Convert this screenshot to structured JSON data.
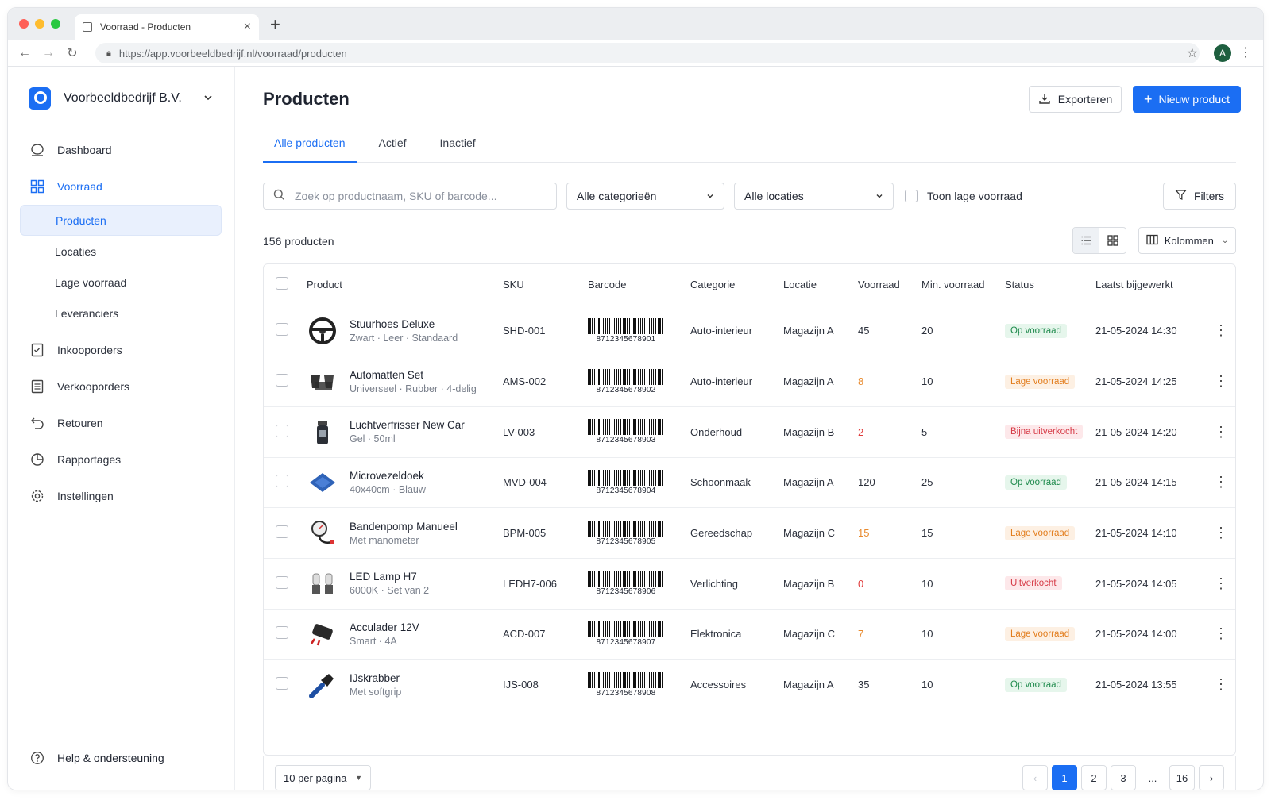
{
  "browser": {
    "tab_title": "Voorraad - Producten",
    "url": "https://app.voorbeeldbedrijf.nl/voorraad/producten",
    "profile_initial": "A"
  },
  "sidebar": {
    "org_name": "Voorbeeldbedrijf B.V.",
    "items": [
      {
        "label": "Dashboard",
        "icon": "chat-bubble-icon"
      },
      {
        "label": "Voorraad",
        "icon": "grid-icon"
      },
      {
        "label": "Inkooporders",
        "icon": "clipboard-check-icon"
      },
      {
        "label": "Verkooporders",
        "icon": "list-doc-icon"
      },
      {
        "label": "Retouren",
        "icon": "return-arrow-icon"
      },
      {
        "label": "Rapportages",
        "icon": "pie-chart-icon"
      },
      {
        "label": "Instellingen",
        "icon": "gear-icon"
      }
    ],
    "sub_items": [
      "Producten",
      "Locaties",
      "Lage voorraad",
      "Leveranciers"
    ],
    "help": "Help & ondersteuning"
  },
  "header": {
    "title": "Producten",
    "export_label": "Exporteren",
    "new_label": "Nieuw product"
  },
  "tabs": [
    "Alle producten",
    "Actief",
    "Inactief"
  ],
  "toolbar": {
    "search_placeholder": "Zoek op productnaam, SKU of barcode...",
    "category": "Alle categorieën",
    "location": "Alle locaties",
    "low_stock": "Toon lage voorraad",
    "filters": "Filters"
  },
  "count": "156 producten",
  "columns_label": "Kolommen",
  "table": {
    "headers": [
      "Product",
      "SKU",
      "Barcode",
      "Categorie",
      "Locatie",
      "Voorraad",
      "Min. voorraad",
      "Status",
      "Laatst bijgewerkt"
    ],
    "rows": [
      {
        "name": "Stuurhoes Deluxe",
        "desc": "Zwart · Leer · Standaard",
        "sku": "SHD-001",
        "barcode": "8712345678901",
        "category": "Auto-interieur",
        "location": "Magazijn A",
        "stock": "45",
        "min": "20",
        "status": "Op voorraad",
        "updated": "21-05-2024 14:30",
        "level": "ok",
        "icon": "steering-wheel-icon"
      },
      {
        "name": "Automatten Set",
        "desc": "Universeel · Rubber · 4-delig",
        "sku": "AMS-002",
        "barcode": "8712345678902",
        "category": "Auto-interieur",
        "location": "Magazijn A",
        "stock": "8",
        "min": "10",
        "status": "Lage voorraad",
        "updated": "21-05-2024 14:25",
        "level": "low",
        "icon": "car-mats-icon"
      },
      {
        "name": "Luchtverfrisser New Car",
        "desc": "Gel · 50ml",
        "sku": "LV-003",
        "barcode": "8712345678903",
        "category": "Onderhoud",
        "location": "Magazijn B",
        "stock": "2",
        "min": "5",
        "status": "Bijna uitverkocht",
        "updated": "21-05-2024 14:20",
        "level": "crit",
        "icon": "spray-bottle-icon"
      },
      {
        "name": "Microvezeldoek",
        "desc": "40x40cm · Blauw",
        "sku": "MVD-004",
        "barcode": "8712345678904",
        "category": "Schoonmaak",
        "location": "Magazijn A",
        "stock": "120",
        "min": "25",
        "status": "Op voorraad",
        "updated": "21-05-2024 14:15",
        "level": "ok",
        "icon": "cloth-icon"
      },
      {
        "name": "Bandenpomp Manueel",
        "desc": "Met manometer",
        "sku": "BPM-005",
        "barcode": "8712345678905",
        "category": "Gereedschap",
        "location": "Magazijn C",
        "stock": "15",
        "min": "15",
        "status": "Lage voorraad",
        "updated": "21-05-2024 14:10",
        "level": "low",
        "icon": "tire-pump-icon"
      },
      {
        "name": "LED Lamp H7",
        "desc": "6000K · Set van 2",
        "sku": "LEDH7-006",
        "barcode": "8712345678906",
        "category": "Verlichting",
        "location": "Magazijn B",
        "stock": "0",
        "min": "10",
        "status": "Uitverkocht",
        "updated": "21-05-2024 14:05",
        "level": "crit",
        "icon": "led-bulb-icon"
      },
      {
        "name": "Acculader 12V",
        "desc": "Smart · 4A",
        "sku": "ACD-007",
        "barcode": "8712345678907",
        "category": "Elektronica",
        "location": "Magazijn C",
        "stock": "7",
        "min": "10",
        "status": "Lage voorraad",
        "updated": "21-05-2024 14:00",
        "level": "low",
        "icon": "battery-charger-icon"
      },
      {
        "name": "IJskrabber",
        "desc": "Met softgrip",
        "sku": "IJS-008",
        "barcode": "8712345678908",
        "category": "Accessoires",
        "location": "Magazijn A",
        "stock": "35",
        "min": "10",
        "status": "Op voorraad",
        "updated": "21-05-2024 13:55",
        "level": "ok",
        "icon": "ice-scraper-icon"
      }
    ]
  },
  "pagination": {
    "per_page": "10 per pagina",
    "pages": [
      "1",
      "2",
      "3",
      "...",
      "16"
    ],
    "current": "1"
  },
  "colors": {
    "accent": "#1b6ef3",
    "ok": "#1e8a4c",
    "low": "#e27d1d",
    "crit": "#d63b47"
  }
}
